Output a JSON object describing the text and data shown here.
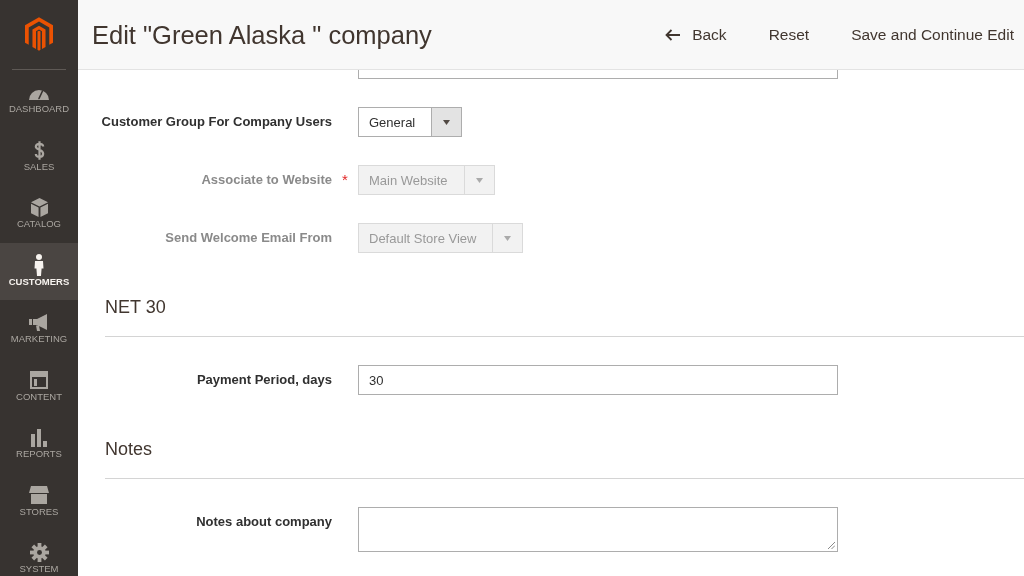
{
  "sidebar": {
    "items": [
      {
        "label": "DASHBOARD",
        "selected": false
      },
      {
        "label": "SALES",
        "selected": false
      },
      {
        "label": "CATALOG",
        "selected": false
      },
      {
        "label": "CUSTOMERS",
        "selected": true
      },
      {
        "label": "MARKETING",
        "selected": false
      },
      {
        "label": "CONTENT",
        "selected": false
      },
      {
        "label": "REPORTS",
        "selected": false
      },
      {
        "label": "STORES",
        "selected": false
      },
      {
        "label": "SYSTEM",
        "selected": false
      }
    ]
  },
  "header": {
    "title": "Edit \"Green Alaska \" company",
    "actions": [
      {
        "kind": "back",
        "label": "Back"
      },
      {
        "kind": "plain",
        "label": "Reset"
      },
      {
        "kind": "plain",
        "label": "Save and Continue Edit"
      }
    ]
  },
  "sections": [
    {
      "fields": [
        {
          "kind": "clipped",
          "disabled": false
        },
        {
          "kind": "select",
          "label": "Customer Group For Company Users",
          "value": "General",
          "disabled": false
        },
        {
          "kind": "select",
          "label": "Associate to Website",
          "required_mark": "*",
          "value": "Main Website",
          "disabled": true
        },
        {
          "kind": "select",
          "label": "Send Welcome Email From",
          "value": "Default Store View",
          "disabled": true
        }
      ]
    },
    {
      "title": "NET 30",
      "fields": [
        {
          "kind": "input",
          "label": "Payment Period, days",
          "value": "30",
          "disabled": false
        }
      ]
    },
    {
      "title": "Notes",
      "fields": [
        {
          "kind": "textarea",
          "label": "Notes about company",
          "disabled": false
        }
      ]
    }
  ]
}
